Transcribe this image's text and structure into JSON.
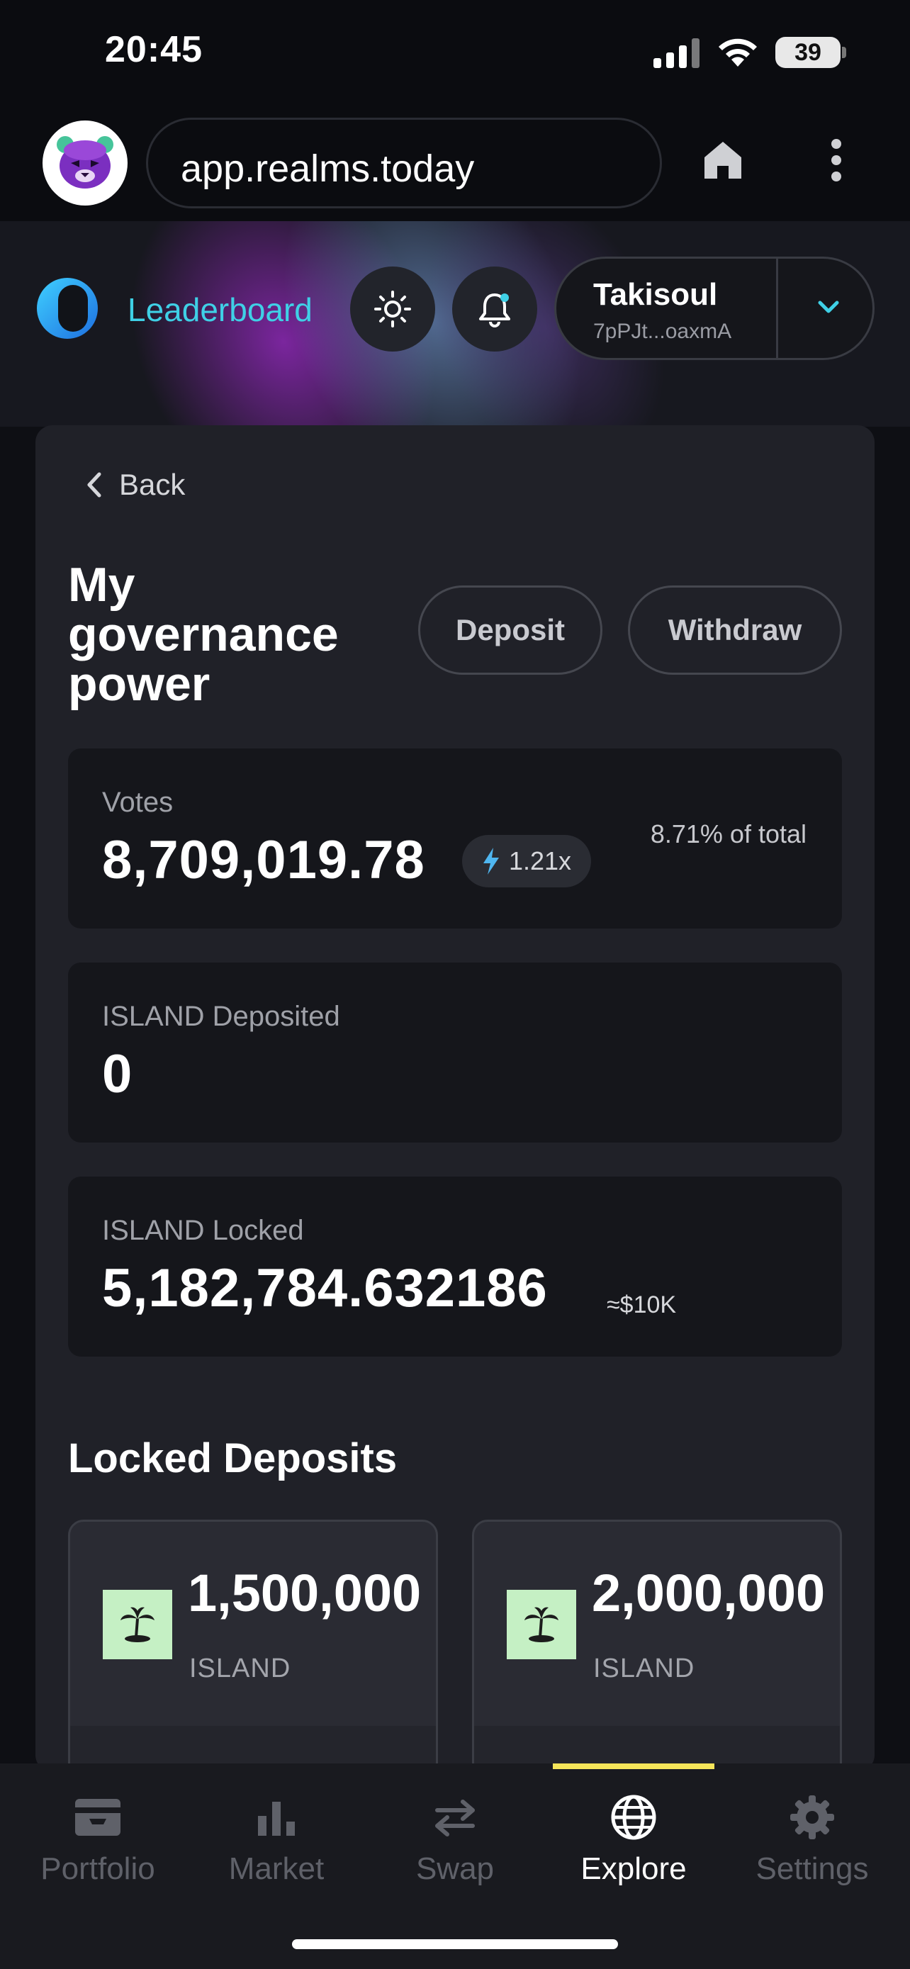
{
  "status_bar": {
    "time": "20:45",
    "battery": "39"
  },
  "browser": {
    "url": "app.realms.today",
    "icons": [
      "tiger-avatar-icon",
      "home-icon",
      "kebab-menu-icon"
    ]
  },
  "header": {
    "nav_label": "Leaderboard",
    "wallet": {
      "name": "Takisoul",
      "address": "7pPJt...oaxmA"
    },
    "icons": [
      "realms-logo-icon",
      "sun-icon",
      "bell-icon",
      "chevron-down-icon"
    ]
  },
  "page": {
    "back_label": "Back",
    "title": "My governance power",
    "deposit_label": "Deposit",
    "withdraw_label": "Withdraw",
    "votes": {
      "label": "Votes",
      "value": "8,709,019.78",
      "multiplier": "1.21x",
      "pct_total": "8.71% of total"
    },
    "deposited": {
      "label": "ISLAND Deposited",
      "value": "0"
    },
    "locked": {
      "label": "ISLAND Locked",
      "value": "5,182,784.632186",
      "approx": "≈$10K"
    },
    "locked_deposits_title": "Locked Deposits",
    "locked_deposits": [
      {
        "amount": "1,500,000",
        "token": "ISLAND"
      },
      {
        "amount": "2,000,000",
        "token": "ISLAND"
      }
    ]
  },
  "bottom_nav": {
    "items": [
      {
        "label": "Portfolio",
        "icon": "wallet-icon"
      },
      {
        "label": "Market",
        "icon": "bar-chart-icon"
      },
      {
        "label": "Swap",
        "icon": "swap-arrows-icon"
      },
      {
        "label": "Explore",
        "icon": "globe-icon"
      },
      {
        "label": "Settings",
        "icon": "gear-icon"
      }
    ],
    "active": "Explore"
  },
  "colors": {
    "accent_cyan": "#3fd0e6",
    "active_indicator": "#f5e55a",
    "bolt": "#4fb6f0",
    "island_tile": "#c5f0c4"
  }
}
